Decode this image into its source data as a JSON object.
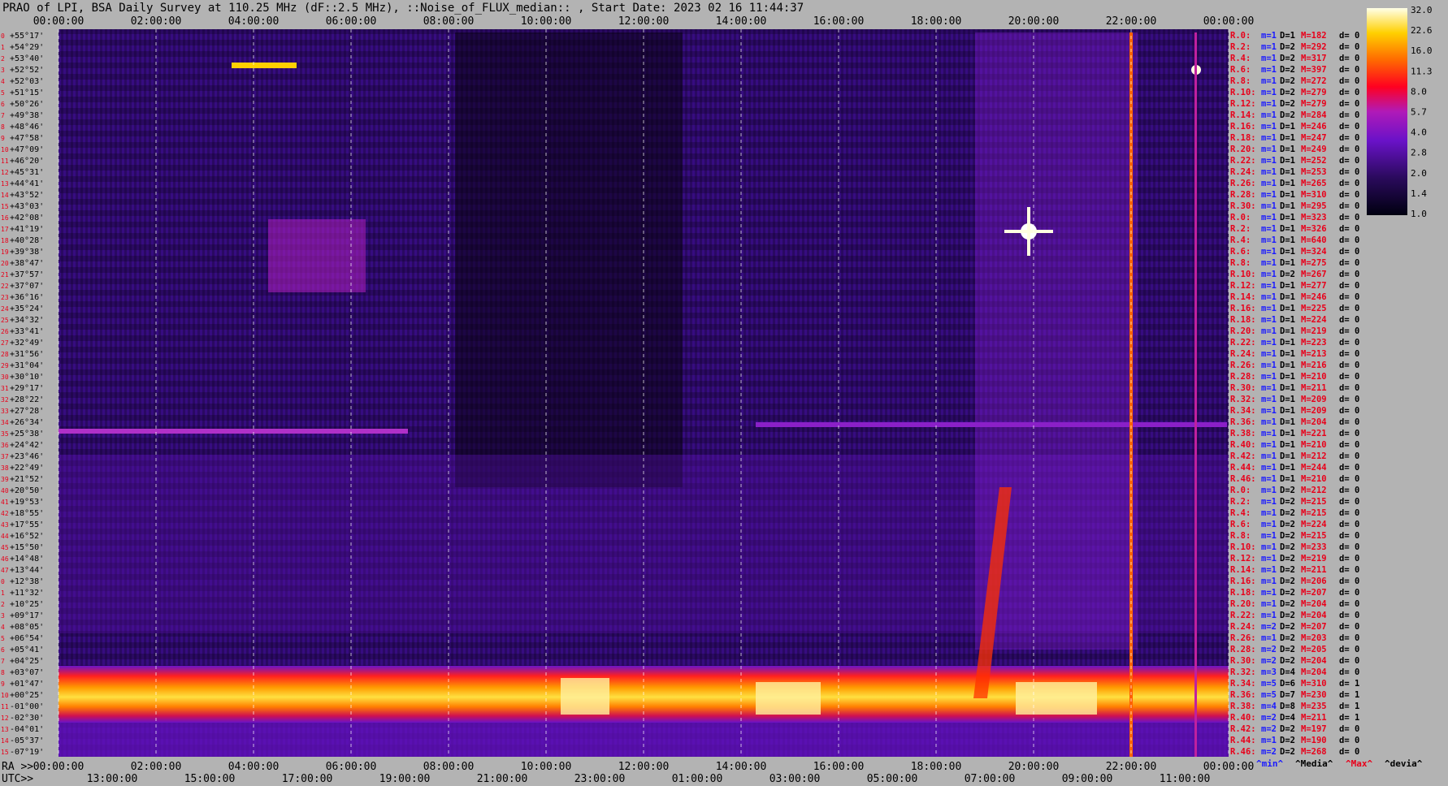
{
  "title": "PRAO of LPI, BSA Daily Survey at 110.25 MHz (dF::2.5 MHz), ::Noise_of_FLUX_median:: , Start Date: 2023 02 16 11:44:37",
  "top_time_labels": [
    "00:00:00",
    "02:00:00",
    "04:00:00",
    "06:00:00",
    "08:00:00",
    "10:00:00",
    "12:00:00",
    "14:00:00",
    "16:00:00",
    "18:00:00",
    "20:00:00",
    "22:00:00",
    "00:00:00"
  ],
  "bottom_ra_prefix": "RA >>",
  "bottom_ra_labels": [
    "00:00:00",
    "02:00:00",
    "04:00:00",
    "06:00:00",
    "08:00:00",
    "10:00:00",
    "12:00:00",
    "14:00:00",
    "16:00:00",
    "18:00:00",
    "20:00:00",
    "22:00:00",
    "00:00:00"
  ],
  "bottom_utc_prefix": "UTC>>",
  "bottom_utc_labels": [
    "13:00:00",
    "15:00:00",
    "17:00:00",
    "19:00:00",
    "21:00:00",
    "23:00:00",
    "01:00:00",
    "03:00:00",
    "05:00:00",
    "07:00:00",
    "09:00:00",
    "11:00:00"
  ],
  "dec_labels": [
    "+55°17'",
    "+54°29'",
    "+53°40'",
    "+52°52'",
    "+52°03'",
    "+51°15'",
    "+50°26'",
    "+49°38'",
    "+48°46'",
    "+47°58'",
    "+47°09'",
    "+46°20'",
    "+45°31'",
    "+44°41'",
    "+43°52'",
    "+43°03'",
    "+42°08'",
    "+41°19'",
    "+40°28'",
    "+39°38'",
    "+38°47'",
    "+37°57'",
    "+37°07'",
    "+36°16'",
    "+35°24'",
    "+34°32'",
    "+33°41'",
    "+32°49'",
    "+31°56'",
    "+31°04'",
    "+30°10'",
    "+29°17'",
    "+28°22'",
    "+27°28'",
    "+26°34'",
    "+25°38'",
    "+24°42'",
    "+23°46'",
    "+22°49'",
    "+21°52'",
    "+20°50'",
    "+19°53'",
    "+18°55'",
    "+17°55'",
    "+16°52'",
    "+15°50'",
    "+14°48'",
    "+13°44'",
    "+12°38'",
    "+11°32'",
    "+10°25'",
    "+09°17'",
    "+08°05'",
    "+06°54'",
    "+05°41'",
    "+04°25'",
    "+03°07'",
    "+01°47'",
    "+00°25'",
    "-01°00'",
    "-02°30'",
    "-04°01'",
    "-05°37'",
    "-07°19'"
  ],
  "right_rows": [
    [
      "R.0:",
      "1",
      "1",
      "182",
      "0"
    ],
    [
      "R.2:",
      "1",
      "2",
      "292",
      "0"
    ],
    [
      "R.4:",
      "1",
      "2",
      "317",
      "0"
    ],
    [
      "R.6:",
      "1",
      "2",
      "397",
      "0"
    ],
    [
      "R.8:",
      "1",
      "2",
      "272",
      "0"
    ],
    [
      "R.10:",
      "1",
      "2",
      "279",
      "0"
    ],
    [
      "R.12:",
      "1",
      "2",
      "279",
      "0"
    ],
    [
      "R.14:",
      "1",
      "2",
      "284",
      "0"
    ],
    [
      "R.16:",
      "1",
      "1",
      "246",
      "0"
    ],
    [
      "R.18:",
      "1",
      "1",
      "247",
      "0"
    ],
    [
      "R.20:",
      "1",
      "1",
      "249",
      "0"
    ],
    [
      "R.22:",
      "1",
      "1",
      "252",
      "0"
    ],
    [
      "R.24:",
      "1",
      "1",
      "253",
      "0"
    ],
    [
      "R.26:",
      "1",
      "1",
      "265",
      "0"
    ],
    [
      "R.28:",
      "1",
      "1",
      "310",
      "0"
    ],
    [
      "R.30:",
      "1",
      "1",
      "295",
      "0"
    ],
    [
      "R.0:",
      "1",
      "1",
      "323",
      "0"
    ],
    [
      "R.2:",
      "1",
      "1",
      "326",
      "0"
    ],
    [
      "R.4:",
      "1",
      "1",
      "640",
      "0"
    ],
    [
      "R.6:",
      "1",
      "1",
      "324",
      "0"
    ],
    [
      "R.8:",
      "1",
      "1",
      "275",
      "0"
    ],
    [
      "R.10:",
      "1",
      "2",
      "267",
      "0"
    ],
    [
      "R.12:",
      "1",
      "1",
      "277",
      "0"
    ],
    [
      "R.14:",
      "1",
      "1",
      "246",
      "0"
    ],
    [
      "R.16:",
      "1",
      "1",
      "225",
      "0"
    ],
    [
      "R.18:",
      "1",
      "1",
      "224",
      "0"
    ],
    [
      "R.20:",
      "1",
      "1",
      "219",
      "0"
    ],
    [
      "R.22:",
      "1",
      "1",
      "223",
      "0"
    ],
    [
      "R.24:",
      "1",
      "1",
      "213",
      "0"
    ],
    [
      "R.26:",
      "1",
      "1",
      "216",
      "0"
    ],
    [
      "R.28:",
      "1",
      "1",
      "210",
      "0"
    ],
    [
      "R.30:",
      "1",
      "1",
      "211",
      "0"
    ],
    [
      "R.32:",
      "1",
      "1",
      "209",
      "0"
    ],
    [
      "R.34:",
      "1",
      "1",
      "209",
      "0"
    ],
    [
      "R.36:",
      "1",
      "1",
      "204",
      "0"
    ],
    [
      "R.38:",
      "1",
      "1",
      "221",
      "0"
    ],
    [
      "R.40:",
      "1",
      "1",
      "210",
      "0"
    ],
    [
      "R.42:",
      "1",
      "1",
      "212",
      "0"
    ],
    [
      "R.44:",
      "1",
      "1",
      "244",
      "0"
    ],
    [
      "R.46:",
      "1",
      "1",
      "210",
      "0"
    ],
    [
      "R.0:",
      "1",
      "2",
      "212",
      "0"
    ],
    [
      "R.2:",
      "1",
      "2",
      "215",
      "0"
    ],
    [
      "R.4:",
      "1",
      "2",
      "215",
      "0"
    ],
    [
      "R.6:",
      "1",
      "2",
      "224",
      "0"
    ],
    [
      "R.8:",
      "1",
      "2",
      "215",
      "0"
    ],
    [
      "R.10:",
      "1",
      "2",
      "233",
      "0"
    ],
    [
      "R.12:",
      "1",
      "2",
      "219",
      "0"
    ],
    [
      "R.14:",
      "1",
      "2",
      "211",
      "0"
    ],
    [
      "R.16:",
      "1",
      "2",
      "206",
      "0"
    ],
    [
      "R.18:",
      "1",
      "2",
      "207",
      "0"
    ],
    [
      "R.20:",
      "1",
      "2",
      "204",
      "0"
    ],
    [
      "R.22:",
      "1",
      "2",
      "204",
      "0"
    ],
    [
      "R.24:",
      "2",
      "2",
      "207",
      "0"
    ],
    [
      "R.26:",
      "1",
      "2",
      "203",
      "0"
    ],
    [
      "R.28:",
      "2",
      "2",
      "205",
      "0"
    ],
    [
      "R.30:",
      "2",
      "2",
      "204",
      "0"
    ],
    [
      "R.32:",
      "3",
      "4",
      "204",
      "0"
    ],
    [
      "R.34:",
      "5",
      "6",
      "310",
      "1"
    ],
    [
      "R.36:",
      "5",
      "7",
      "230",
      "1"
    ],
    [
      "R.38:",
      "4",
      "8",
      "235",
      "1"
    ],
    [
      "R.40:",
      "2",
      "4",
      "211",
      "1"
    ],
    [
      "R.42:",
      "2",
      "2",
      "197",
      "0"
    ],
    [
      "R.44:",
      "1",
      "2",
      "190",
      "0"
    ],
    [
      "R.46:",
      "2",
      "2",
      "268",
      "0"
    ]
  ],
  "footer_legend": [
    "^min^",
    "^Media^",
    "^Max^",
    "^devia^"
  ],
  "colorbar_ticks": [
    "32.0",
    "22.6",
    "16.0",
    "11.3",
    "8.0",
    "5.7",
    "4.0",
    "2.8",
    "2.0",
    "1.4",
    "1.0"
  ],
  "colors": {
    "background": "#b3b3b3",
    "label_red": "#e8001a",
    "label_blue": "#1a1aff",
    "text_black": "#000000"
  }
}
